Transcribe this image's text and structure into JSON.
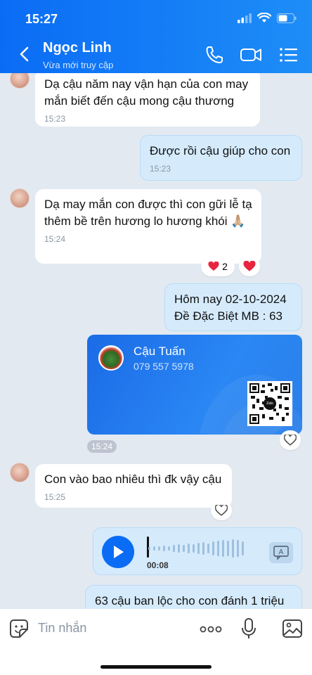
{
  "status_bar": {
    "time": "15:27"
  },
  "header": {
    "name": "Ngọc Linh",
    "status": "Vừa mới truy cập"
  },
  "messages": [
    {
      "text": "Dạ cậu năm nay vận hạn của con may mắn biết đến cậu mong cậu thương",
      "time": "15:23"
    },
    {
      "text": "Được rồi cậu giúp cho con",
      "time": "15:23"
    },
    {
      "text": "Dạ may mắn con được thì con gữi lễ tạ thêm bề trên hương lo hương khói 🙏🏼",
      "time": "15:24",
      "reaction_count": "2"
    },
    {
      "line1": "Hôm nay 02-10-2024",
      "line2": "Đề Đặc Biệt MB : 63"
    },
    {
      "text": "Con vào bao nhiêu thì đk vậy cậu",
      "time": "15:25"
    },
    {
      "text": "63 cậu ban lộc cho con đánh 1 triệu"
    }
  ],
  "contact_card": {
    "name": "Cậu Tuấn",
    "phone": "079 557 5978",
    "time": "15:24",
    "qr_logo": "Zalo"
  },
  "voice_message": {
    "duration": "00:08"
  },
  "composer": {
    "placeholder": "Tin nhắn"
  },
  "colors": {
    "header": "#0a6cf5",
    "outgoing_bubble": "#d5ebfc",
    "background": "#e2e9f1"
  }
}
